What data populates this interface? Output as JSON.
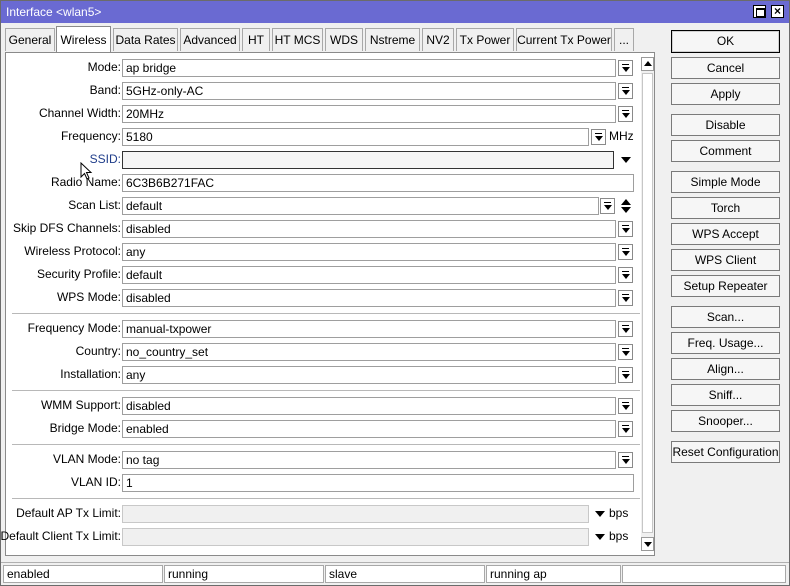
{
  "window": {
    "title": "Interface <wlan5>"
  },
  "tabs": [
    {
      "label": "General"
    },
    {
      "label": "Wireless"
    },
    {
      "label": "Data Rates"
    },
    {
      "label": "Advanced"
    },
    {
      "label": "HT"
    },
    {
      "label": "HT MCS"
    },
    {
      "label": "WDS"
    },
    {
      "label": "Nstreme"
    },
    {
      "label": "NV2"
    },
    {
      "label": "Tx Power"
    },
    {
      "label": "Current Tx Power"
    },
    {
      "label": "..."
    }
  ],
  "fields": {
    "mode": {
      "label": "Mode:",
      "value": "ap bridge"
    },
    "band": {
      "label": "Band:",
      "value": "5GHz-only-AC"
    },
    "channel_width": {
      "label": "Channel Width:",
      "value": "20MHz"
    },
    "frequency": {
      "label": "Frequency:",
      "value": "5180",
      "unit": "MHz"
    },
    "ssid": {
      "label": "SSID:",
      "value": ""
    },
    "radio_name": {
      "label": "Radio Name:",
      "value": "6C3B6B271FAC"
    },
    "scan_list": {
      "label": "Scan List:",
      "value": "default"
    },
    "skip_dfs": {
      "label": "Skip DFS Channels:",
      "value": "disabled"
    },
    "wireless_protocol": {
      "label": "Wireless Protocol:",
      "value": "any"
    },
    "security_profile": {
      "label": "Security Profile:",
      "value": "default"
    },
    "wps_mode": {
      "label": "WPS Mode:",
      "value": "disabled"
    },
    "frequency_mode": {
      "label": "Frequency Mode:",
      "value": "manual-txpower"
    },
    "country": {
      "label": "Country:",
      "value": "no_country_set"
    },
    "installation": {
      "label": "Installation:",
      "value": "any"
    },
    "wmm_support": {
      "label": "WMM Support:",
      "value": "disabled"
    },
    "bridge_mode": {
      "label": "Bridge Mode:",
      "value": "enabled"
    },
    "vlan_mode": {
      "label": "VLAN Mode:",
      "value": "no tag"
    },
    "vlan_id": {
      "label": "VLAN ID:",
      "value": "1"
    },
    "default_ap_tx_limit": {
      "label": "Default AP Tx Limit:",
      "value": "",
      "unit": "bps"
    },
    "default_client_tx_limit": {
      "label": "Default Client Tx Limit:",
      "value": "",
      "unit": "bps"
    }
  },
  "buttons": {
    "ok": "OK",
    "cancel": "Cancel",
    "apply": "Apply",
    "disable": "Disable",
    "comment": "Comment",
    "simple_mode": "Simple Mode",
    "torch": "Torch",
    "wps_accept": "WPS Accept",
    "wps_client": "WPS Client",
    "setup_repeater": "Setup Repeater",
    "scan": "Scan...",
    "freq_usage": "Freq. Usage...",
    "align": "Align...",
    "sniff": "Sniff...",
    "snooper": "Snooper...",
    "reset_configuration": "Reset Configuration"
  },
  "status": [
    "enabled",
    "running",
    "slave",
    "running ap",
    ""
  ],
  "colors": {
    "titlebar": "#6a6ad2",
    "ssid_label": "#1f3d8a"
  }
}
